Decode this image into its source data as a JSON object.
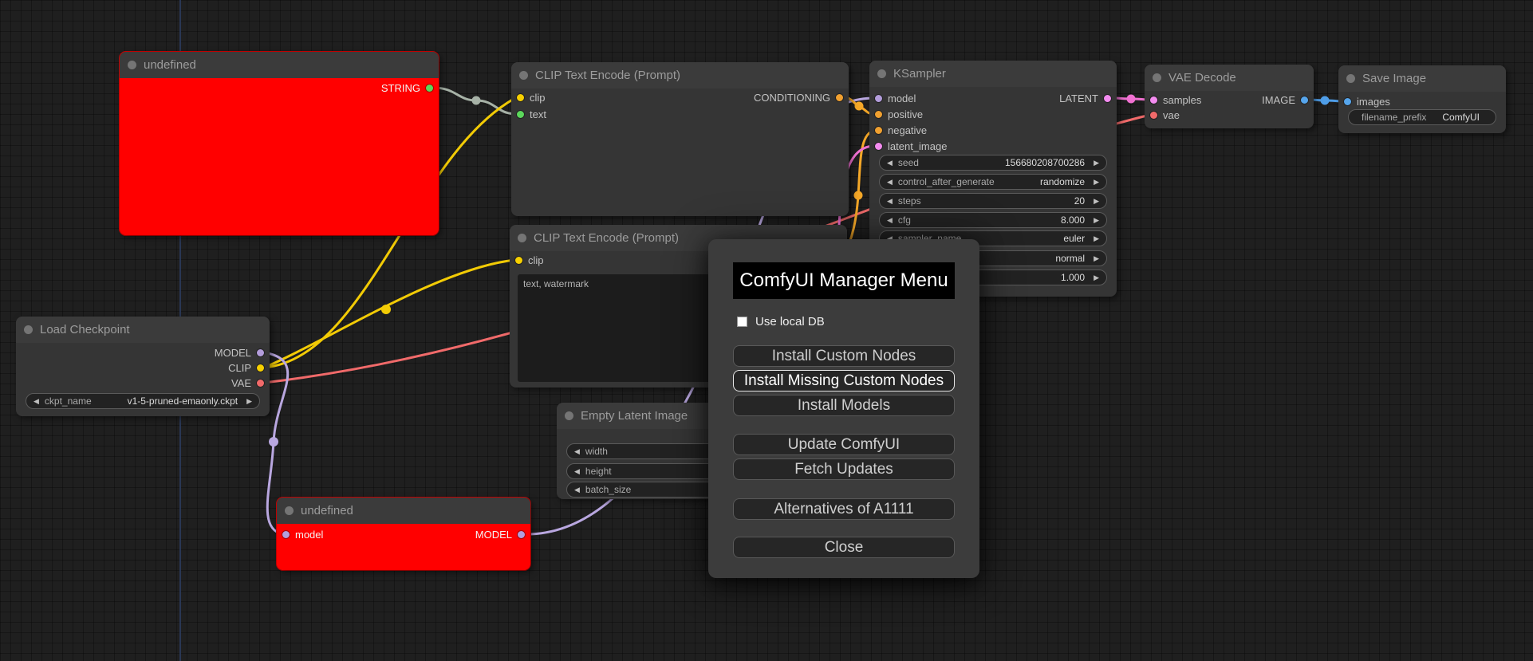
{
  "colors": {
    "model_link": "#b9a7e0",
    "model_slot": "#b39ddb",
    "clip_link": "#f2cb05",
    "clip_slot": "#f7d000",
    "vae_link": "#f16a6a",
    "vae_slot": "#f16a6a",
    "conditioning_link": "#f5a828",
    "conditioning_slot": "#f0a030",
    "latent_link": "#f171d2",
    "latent_slot": "#f48cf0",
    "image_link": "#4f9ee8",
    "image_slot": "#56a5ec",
    "string_link": "#a7b2a7",
    "string_slot": "#5bd75b",
    "error_node": "#ff0000",
    "title_dot": "#757575"
  },
  "ui": {
    "arrow_left": "◀",
    "arrow_right": "▶"
  },
  "nodes": {
    "undefined_top": {
      "title": "undefined",
      "outputs": [
        {
          "label": "STRING"
        }
      ]
    },
    "clip_encode_1": {
      "title": "CLIP Text Encode (Prompt)",
      "inputs": [
        {
          "label": "clip"
        },
        {
          "label": "text"
        }
      ],
      "outputs": [
        {
          "label": "CONDITIONING"
        }
      ]
    },
    "ksampler": {
      "title": "KSampler",
      "inputs": [
        {
          "label": "model"
        },
        {
          "label": "positive"
        },
        {
          "label": "negative"
        },
        {
          "label": "latent_image"
        }
      ],
      "outputs": [
        {
          "label": "LATENT"
        }
      ],
      "widgets": [
        {
          "label": "seed",
          "value": "156680208700286"
        },
        {
          "label": "control_after_generate",
          "value": "randomize"
        },
        {
          "label": "steps",
          "value": "20"
        },
        {
          "label": "cfg",
          "value": "8.000"
        },
        {
          "label": "sampler_name",
          "value": "euler"
        },
        {
          "label": "",
          "value": "normal"
        },
        {
          "label": "",
          "value": "1.000"
        }
      ]
    },
    "vae_decode": {
      "title": "VAE Decode",
      "inputs": [
        {
          "label": "samples"
        },
        {
          "label": "vae"
        }
      ],
      "outputs": [
        {
          "label": "IMAGE"
        }
      ]
    },
    "save_image": {
      "title": "Save Image",
      "inputs": [
        {
          "label": "images"
        }
      ],
      "widgets": [
        {
          "label": "filename_prefix",
          "value": "ComfyUI"
        }
      ]
    },
    "load_checkpoint": {
      "title": "Load Checkpoint",
      "outputs": [
        {
          "label": "MODEL"
        },
        {
          "label": "CLIP"
        },
        {
          "label": "VAE"
        }
      ],
      "widgets": [
        {
          "label": "ckpt_name",
          "value": "v1-5-pruned-emaonly.ckpt"
        }
      ]
    },
    "clip_encode_2": {
      "title": "CLIP Text Encode (Prompt)",
      "inputs": [
        {
          "label": "clip"
        }
      ],
      "text_value": "text, watermark"
    },
    "empty_latent": {
      "title": "Empty Latent Image",
      "widgets": [
        {
          "label": "width"
        },
        {
          "label": "height"
        },
        {
          "label": "batch_size"
        }
      ]
    },
    "undefined_bottom": {
      "title": "undefined",
      "inputs": [
        {
          "label": "model"
        }
      ],
      "outputs": [
        {
          "label": "MODEL"
        }
      ]
    }
  },
  "dialog": {
    "title": "ComfyUI Manager Menu",
    "checkbox_label": "Use local DB",
    "buttons": [
      "Install Custom Nodes",
      "Install Missing Custom Nodes",
      "Install Models",
      "Update ComfyUI",
      "Fetch Updates",
      "Alternatives of A1111",
      "Close"
    ]
  }
}
